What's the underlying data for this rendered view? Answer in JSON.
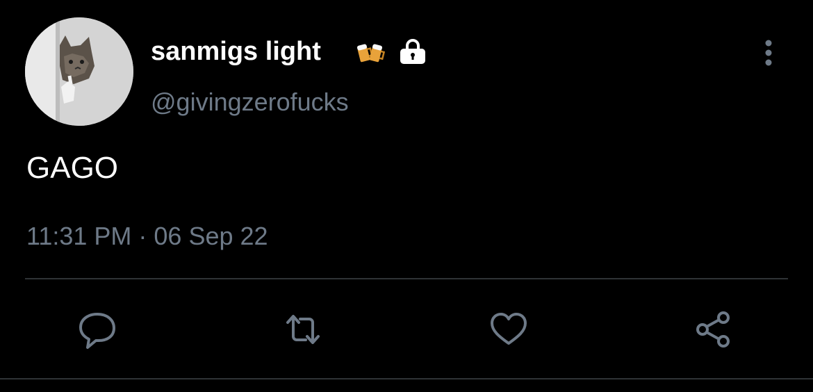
{
  "author": {
    "display_name": "sanmigs light",
    "handle": "@givingzerofucks",
    "badges": [
      "beer-mugs-emoji",
      "lock-icon"
    ]
  },
  "tweet": {
    "text": "GAGO",
    "timestamp": "11:31 PM · 06 Sep 22"
  },
  "actions": [
    "reply-icon",
    "retweet-icon",
    "like-icon",
    "share-icon"
  ],
  "colors": {
    "background": "#000000",
    "primary_text": "#ffffff",
    "secondary_text": "#6e7a88",
    "divider": "#2f3336"
  }
}
